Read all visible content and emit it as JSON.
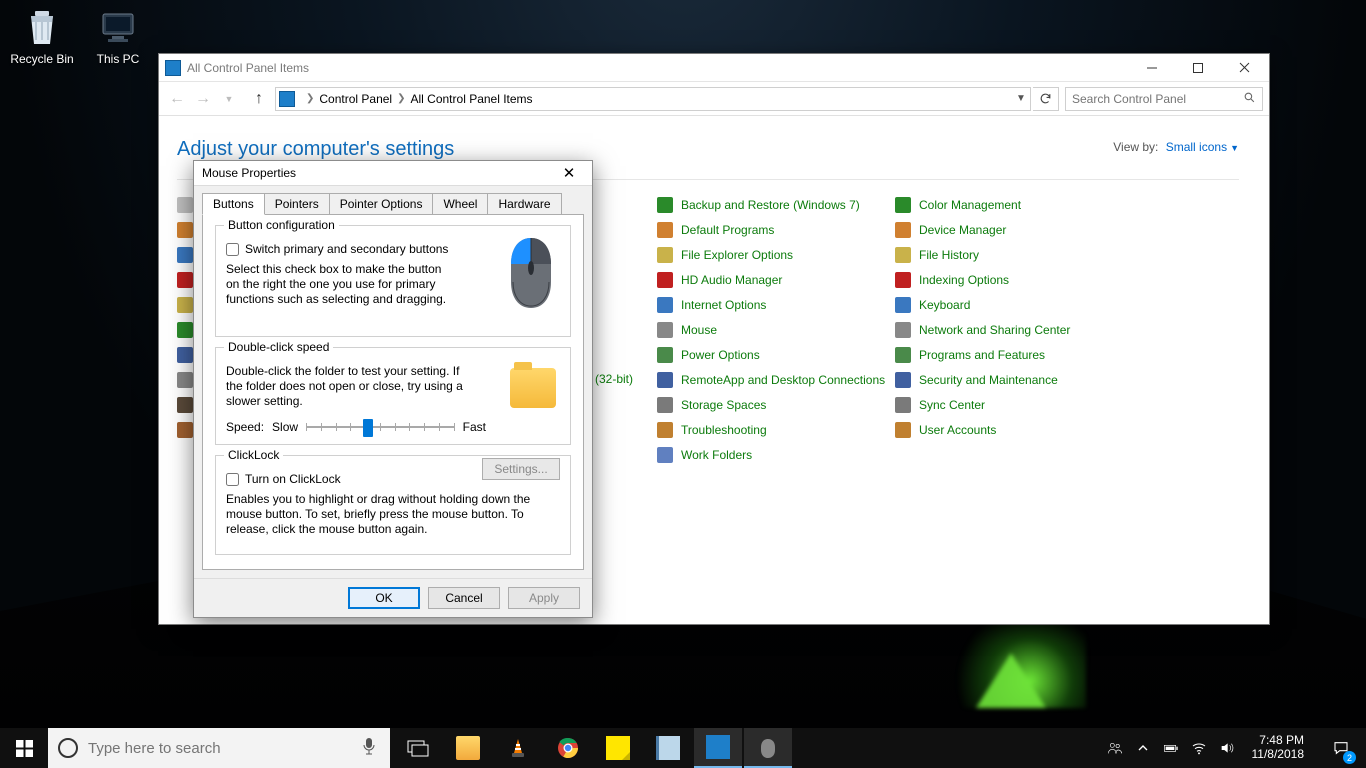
{
  "desktop": {
    "recycle_bin": "Recycle Bin",
    "this_pc": "This PC"
  },
  "control_panel": {
    "window_title": "All Control Panel Items",
    "breadcrumb": [
      "Control Panel",
      "All Control Panel Items"
    ],
    "search_placeholder": "Search Control Panel",
    "heading": "Adjust your computer's settings",
    "view_by_label": "View by:",
    "view_by_value": "Small icons",
    "column1_visible_fragment": "(32-bit)",
    "column2": [
      "Backup and Restore (Windows 7)",
      "Default Programs",
      "File Explorer Options",
      "HD Audio Manager",
      "Internet Options",
      "Mouse",
      "Power Options",
      "RemoteApp and Desktop Connections",
      "Storage Spaces",
      "Troubleshooting",
      "Work Folders"
    ],
    "column3": [
      "Color Management",
      "Device Manager",
      "File History",
      "Indexing Options",
      "Keyboard",
      "Network and Sharing Center",
      "Programs and Features",
      "Security and Maintenance",
      "Sync Center",
      "User Accounts"
    ]
  },
  "mouse_dialog": {
    "title": "Mouse Properties",
    "tabs": [
      "Buttons",
      "Pointers",
      "Pointer Options",
      "Wheel",
      "Hardware"
    ],
    "active_tab": "Buttons",
    "group1": {
      "title": "Button configuration",
      "checkbox": "Switch primary and secondary buttons",
      "desc": "Select this check box to make the button on the right the one you use for primary functions such as selecting and dragging."
    },
    "group2": {
      "title": "Double-click speed",
      "desc": "Double-click the folder to test your setting. If the folder does not open or close, try using a slower setting.",
      "speed_label": "Speed:",
      "slow": "Slow",
      "fast": "Fast"
    },
    "group3": {
      "title": "ClickLock",
      "checkbox": "Turn on ClickLock",
      "settings_btn": "Settings...",
      "desc": "Enables you to highlight or drag without holding down the mouse button. To set, briefly press the mouse button. To release, click the mouse button again."
    },
    "buttons": {
      "ok": "OK",
      "cancel": "Cancel",
      "apply": "Apply"
    }
  },
  "taskbar": {
    "search_placeholder": "Type here to search",
    "time": "7:48 PM",
    "date": "11/8/2018",
    "notification_count": "2"
  }
}
